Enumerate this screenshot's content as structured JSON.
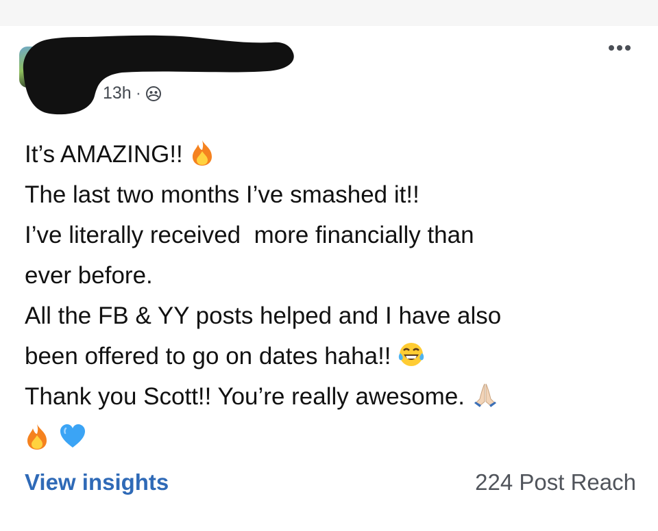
{
  "post": {
    "time": "13h",
    "separator": "·",
    "audience_icon": "friends-icon",
    "more_icon": "more-options-icon",
    "lines": [
      "It’s AMAZING!! ",
      "The last two months I’ve smashed it!!",
      "I’ve literally received  more financially than",
      "ever before.",
      "All the FB & YY posts helped and I have also",
      "been offered to go on dates haha!! ",
      "Thank you Scott!! You’re really awesome. "
    ],
    "emojis": [
      "fire-emoji",
      "tears-of-joy-emoji",
      "folded-hands-emoji",
      "fire-emoji",
      "blue-heart-emoji"
    ]
  },
  "footer": {
    "view_insights": "View insights",
    "post_reach": "224 Post Reach"
  },
  "colors": {
    "link_blue": "#2f6ab7",
    "redaction": "#111111"
  }
}
